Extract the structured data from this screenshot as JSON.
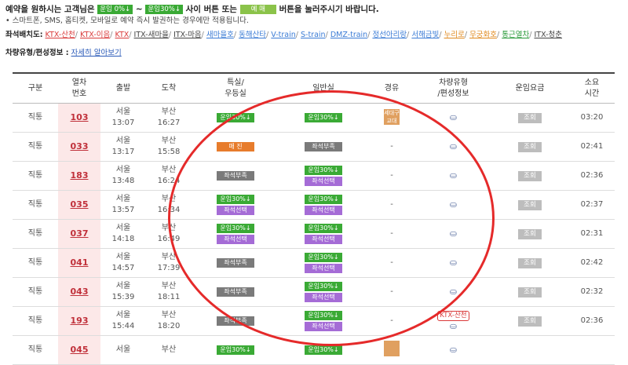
{
  "notice": {
    "line1_a": "예약을 원하시는 고객님은",
    "chip1": "운임 0%↓",
    "sep": "~",
    "chip2": "운임30%↓",
    "line1_b": "사이 버튼 또는",
    "chip3": "예 매",
    "line1_c": "버튼을 눌러주시기 바랍니다.",
    "line2": "• 스마트폰, SMS, 홈티켓, 모바일로 예약 즉시 발권하는 경우에만 적용됩니다."
  },
  "seat_layout": {
    "label": "좌석배치도:",
    "links": [
      {
        "text": "KTX-산천",
        "color": "red"
      },
      {
        "text": "KTX-이음",
        "color": "red"
      },
      {
        "text": "KTX",
        "color": "red"
      },
      {
        "text": "ITX-새마을",
        "color": "plain"
      },
      {
        "text": "ITX-마음",
        "color": "plain"
      },
      {
        "text": "새마을호",
        "color": "blue"
      },
      {
        "text": "동해산타",
        "color": "blue"
      },
      {
        "text": "V-train",
        "color": "blue"
      },
      {
        "text": "S-train",
        "color": "blue"
      },
      {
        "text": "DMZ-train",
        "color": "blue"
      },
      {
        "text": "정선아리랑",
        "color": "blue"
      },
      {
        "text": "서해금빛",
        "color": "blue"
      },
      {
        "text": "누리로",
        "color": "orange"
      },
      {
        "text": "무궁화호",
        "color": "orange"
      },
      {
        "text": "통근열차",
        "color": "green"
      },
      {
        "text": "ITX-청춘",
        "color": "plain"
      }
    ]
  },
  "car_info": {
    "label": "차량유형/편성정보 :",
    "link": "자세히 알아보기"
  },
  "table": {
    "headers": [
      "구분",
      "열차\n번호",
      "출발",
      "도착",
      "특실/\n우등실",
      "일반실",
      "경유",
      "차량유형\n/편성정보",
      "운임요금",
      "소요\n시간"
    ],
    "rows": [
      {
        "type": "직통",
        "no": "103",
        "dep": "서울",
        "dep_t": "13:07",
        "arr": "부산",
        "arr_t": "16:27",
        "special": [
          "운임30%↓"
        ],
        "general": [
          "운임30%↓"
        ],
        "via": "세대구\n교대",
        "car": "seat",
        "fare": "조회",
        "dur": "03:20"
      },
      {
        "type": "직통",
        "no": "033",
        "dep": "서울",
        "dep_t": "13:17",
        "arr": "부산",
        "arr_t": "15:58",
        "special": [
          "매 진"
        ],
        "general": [
          "좌석부족"
        ],
        "via": "-",
        "car": "seat",
        "fare": "조회",
        "dur": "02:41"
      },
      {
        "type": "직통",
        "no": "183",
        "dep": "서울",
        "dep_t": "13:48",
        "arr": "부산",
        "arr_t": "16:24",
        "special": [
          "좌석부족"
        ],
        "general": [
          "운임30%↓",
          "좌석선택"
        ],
        "via": "-",
        "car": "seat",
        "fare": "조회",
        "dur": "02:36"
      },
      {
        "type": "직통",
        "no": "035",
        "dep": "서울",
        "dep_t": "13:57",
        "arr": "부산",
        "arr_t": "16:34",
        "special": [
          "운임30%↓",
          "좌석선택"
        ],
        "general": [
          "운임30%↓",
          "좌석선택"
        ],
        "via": "-",
        "car": "seat",
        "fare": "조회",
        "dur": "02:37"
      },
      {
        "type": "직통",
        "no": "037",
        "dep": "서울",
        "dep_t": "14:18",
        "arr": "부산",
        "arr_t": "16:49",
        "special": [
          "운임30%↓",
          "좌석선택"
        ],
        "general": [
          "운임30%↓",
          "좌석선택"
        ],
        "via": "-",
        "car": "seat",
        "fare": "조회",
        "dur": "02:31"
      },
      {
        "type": "직통",
        "no": "041",
        "dep": "서울",
        "dep_t": "14:57",
        "arr": "부산",
        "arr_t": "17:39",
        "special": [
          "좌석부족"
        ],
        "general": [
          "운임30%↓",
          "좌석선택"
        ],
        "via": "-",
        "car": "seat",
        "fare": "조회",
        "dur": "02:42"
      },
      {
        "type": "직통",
        "no": "043",
        "dep": "서울",
        "dep_t": "15:39",
        "arr": "부산",
        "arr_t": "18:11",
        "special": [
          "좌석부족"
        ],
        "general": [
          "운임30%↓",
          "좌석선택"
        ],
        "via": "-",
        "car": "seat",
        "fare": "조회",
        "dur": "02:32"
      },
      {
        "type": "직통",
        "no": "193",
        "dep": "서울",
        "dep_t": "15:44",
        "arr": "부산",
        "arr_t": "18:20",
        "special": [
          "좌석부족"
        ],
        "general": [
          "운임30%↓",
          "좌석선택"
        ],
        "via": "-",
        "car": "ktx",
        "car_label": "KTX-산천",
        "fare": "조회",
        "dur": "02:36"
      },
      {
        "type": "직통",
        "no": "045",
        "dep": "서울",
        "dep_t": "",
        "arr": "부산",
        "arr_t": "",
        "special": [
          "운임30%↓"
        ],
        "general": [
          "운임30%↓"
        ],
        "via": "box",
        "car": "seat",
        "fare": "",
        "dur": ""
      }
    ]
  },
  "colors": {
    "accent_red": "#e52a2a",
    "green_badge": "#3aaa35",
    "purple_badge": "#a56cd6",
    "gray_badge": "#7a7a7a",
    "orange_badge": "#e77c2c"
  }
}
